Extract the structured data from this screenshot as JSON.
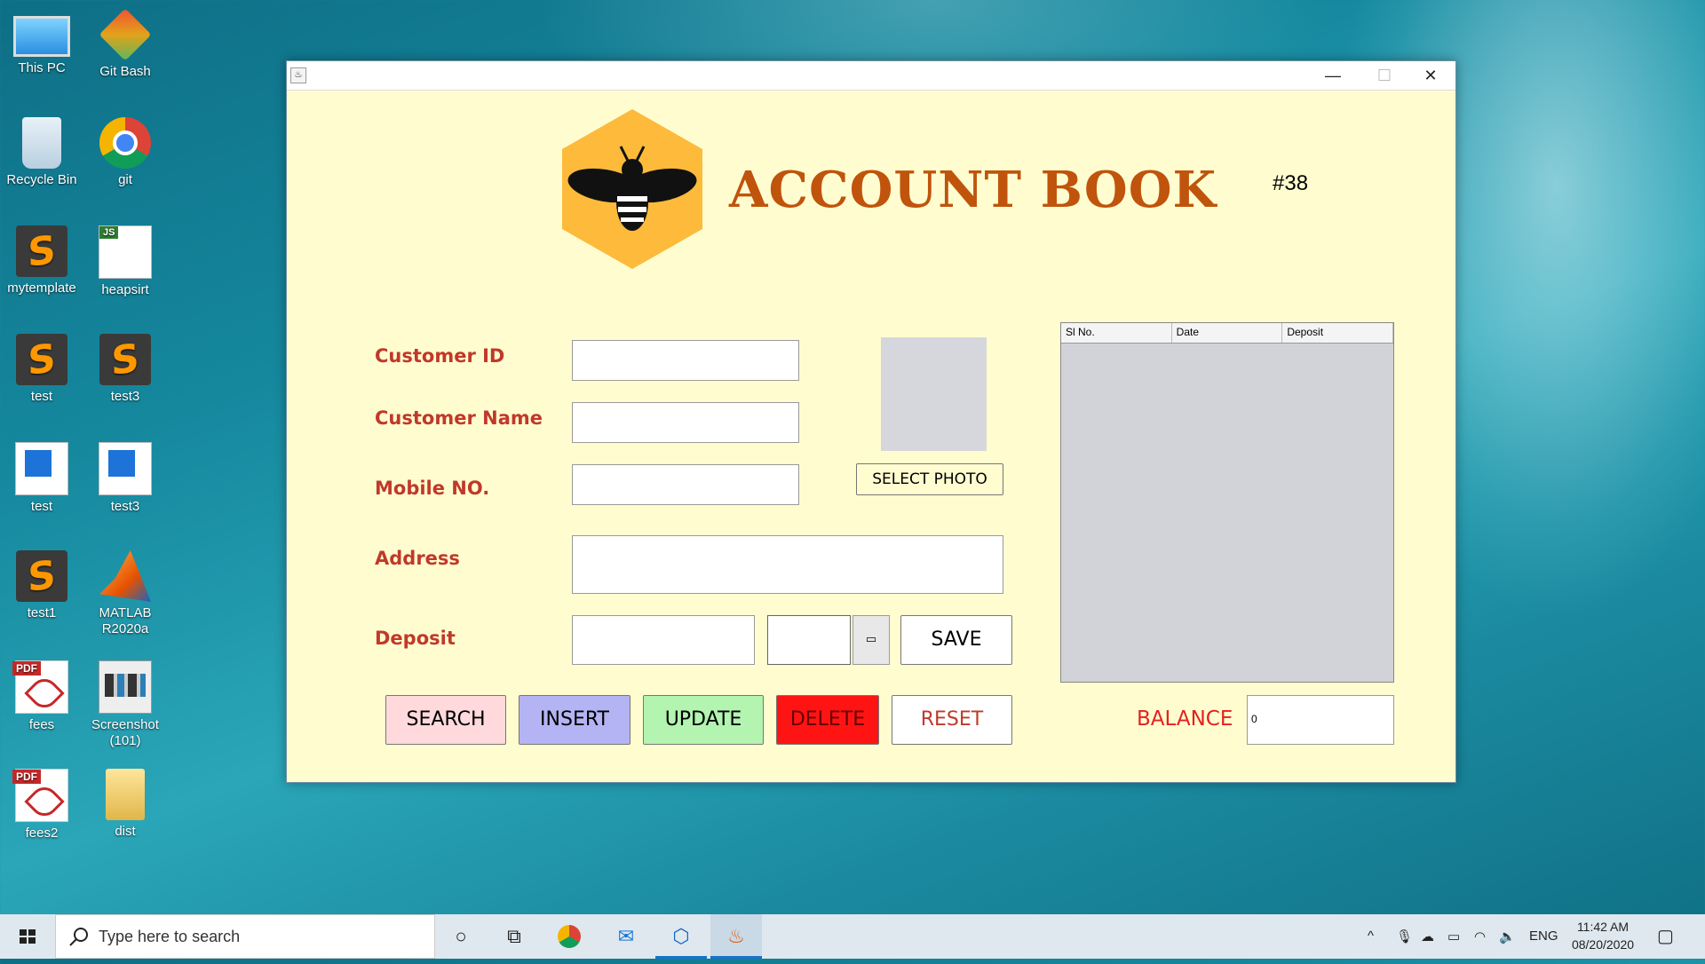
{
  "desktop": {
    "icons": [
      {
        "label": "This PC",
        "icon": "pc-icon"
      },
      {
        "label": "Git Bash",
        "icon": "git-bash-icon"
      },
      {
        "label": "Recycle Bin",
        "icon": "recycle-bin-icon"
      },
      {
        "label": "git",
        "icon": "chrome-icon"
      },
      {
        "label": "mytemplate",
        "icon": "sublime-icon"
      },
      {
        "label": "heapsirt",
        "icon": "js-file-icon"
      },
      {
        "label": "test",
        "icon": "sublime-icon"
      },
      {
        "label": "test3",
        "icon": "sublime-icon"
      },
      {
        "label": "test",
        "icon": "notepad-icon"
      },
      {
        "label": "test3",
        "icon": "notepad-icon"
      },
      {
        "label": "test1",
        "icon": "sublime-icon"
      },
      {
        "label": "MATLAB R2020a",
        "icon": "matlab-icon"
      },
      {
        "label": "fees",
        "icon": "pdf-icon"
      },
      {
        "label": "Screenshot (101)",
        "icon": "image-icon"
      },
      {
        "label": "fees2",
        "icon": "pdf-icon"
      },
      {
        "label": "dist",
        "icon": "folder-icon"
      }
    ],
    "pdf_tag": "PDF",
    "js_tag": "JS"
  },
  "window": {
    "title": "",
    "controls": {
      "minimize": "—",
      "maximize": "☐",
      "close": "✕"
    }
  },
  "app": {
    "title": "ACCOUNT BOOK",
    "record_number": "#38",
    "labels": {
      "customer_id": "Customer ID",
      "customer_name": "Customer Name",
      "mobile": "Mobile NO.",
      "address": "Address",
      "deposit": "Deposit",
      "balance": "BALANCE"
    },
    "fields": {
      "customer_id": "",
      "customer_name": "",
      "mobile": "",
      "address": "",
      "deposit": "",
      "date": "",
      "balance": "0"
    },
    "buttons": {
      "select_photo": "SELECT PHOTO",
      "save": "SAVE",
      "search": "SEARCH",
      "insert": "INSERT",
      "update": "UPDATE",
      "delete": "DELETE",
      "reset": "RESET"
    },
    "table": {
      "columns": [
        "Sl No.",
        "Date",
        "Deposit"
      ],
      "rows": []
    },
    "colors": {
      "background": "#fffdd0",
      "label": "#c0392b",
      "title": "#c0540c",
      "search": "#ffd9dc",
      "insert": "#b4b4f4",
      "update": "#b2f4b0",
      "delete": "#ff1414",
      "reset": "#ffffff"
    }
  },
  "taskbar": {
    "search_placeholder": "Type here to search",
    "language": "ENG",
    "time": "11:42 AM",
    "date": "08/20/2020"
  }
}
